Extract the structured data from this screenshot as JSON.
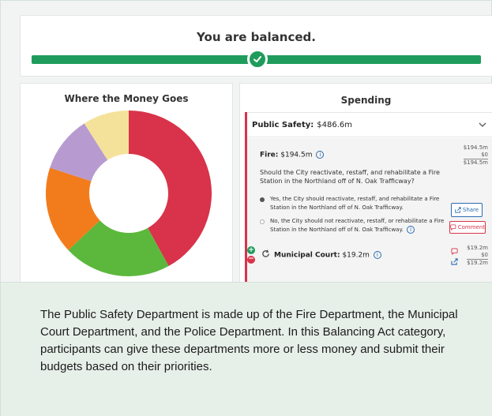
{
  "banner": {
    "title": "You are balanced."
  },
  "left_panel": {
    "title": "Where the Money Goes"
  },
  "donut": {
    "segments": [
      {
        "color": "#d8334a",
        "value": 0.42
      },
      {
        "color": "#5cb83c",
        "value": 0.21
      },
      {
        "color": "#f27c1c",
        "value": 0.17
      },
      {
        "color": "#b79bd0",
        "value": 0.11
      },
      {
        "color": "#f5e29a",
        "value": 0.09
      }
    ]
  },
  "right_panel": {
    "title": "Spending",
    "category": {
      "name": "Public Safety:",
      "amount": "$486.6m"
    },
    "fire": {
      "name": "Fire:",
      "amount": "$194.5m",
      "info": "i",
      "vals": [
        "$194.5m",
        "$0",
        "$194.5m"
      ],
      "question": "Should the City reactivate, restaff, and rehabilitate a Fire Station in the Northland off of N. Oak Trafficway?",
      "option_yes": "Yes, the City should reactivate, restaff, and rehabilitate a Fire Station in the Northland off of N. Oak Trafficway.",
      "option_no": "No, the City should not reactivate, restaff, or rehabilitate a Fire Station in the Northland off of N. Oak Trafficway.",
      "share_label": "Share",
      "comment_label": "Comment"
    },
    "court": {
      "name": "Municipal Court:",
      "amount": "$19.2m",
      "info": "i",
      "vals": [
        "$19.2m",
        "$0",
        "$19.2m"
      ]
    }
  },
  "description": {
    "text": "The Public Safety Department is made up of the Fire Department, the Municipal Court Department, and the Police Department. In this Balancing Act category, participants can give these departments more or less money and submit their budgets based on their priorities."
  }
}
